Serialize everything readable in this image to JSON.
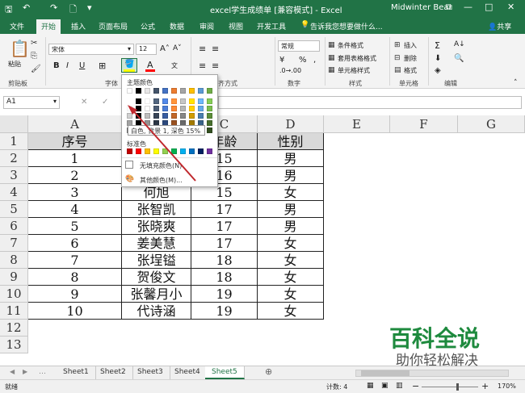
{
  "window": {
    "title": "excel学生成绩单 [兼容模式] - Excel",
    "user": "Midwinter Bear",
    "minimize": "—",
    "maximize": "□",
    "close": "✕",
    "restore": "⧉"
  },
  "quick_access": {
    "save": "🖫",
    "undo": "↶",
    "redo": "↷",
    "new": "🗋",
    "more": "▾"
  },
  "tabs": [
    "文件",
    "开始",
    "插入",
    "页面布局",
    "公式",
    "数据",
    "审阅",
    "视图",
    "开发工具"
  ],
  "active_tab": "开始",
  "tell_me": "告诉我您想要做什么...",
  "share": "共享",
  "ribbon": {
    "paste": "粘贴",
    "clipboard_group": "剪贴板",
    "font_name": "宋体",
    "font_size": "12",
    "bold": "B",
    "italic": "I",
    "underline": "U",
    "font_color_letter": "A",
    "font_group": "字体",
    "align_group": "对齐方式",
    "number_format": "常规",
    "currency": "¥",
    "percent": "%",
    "comma": ",",
    "number_group": "数字",
    "conditional_format": "条件格式",
    "table_format": "套用表格格式",
    "cell_style": "单元格样式",
    "styles_group": "样式",
    "insert": "插入",
    "delete": "删除",
    "format": "格式",
    "cells_group": "单元格",
    "editing_group": "编辑",
    "sum_icon": "Σ",
    "sort_icon": "A↓"
  },
  "formula_bar": {
    "name_box": "A1",
    "cancel": "✕",
    "confirm": "✓",
    "fx": "fx"
  },
  "palette": {
    "theme_title": "主题颜色",
    "standard_title": "标准色",
    "no_fill": "无填充颜色(N)",
    "more_colors": "其他颜色(M)...",
    "tooltip": "白色, 背景 1, 深色 15%",
    "theme_row": [
      "#ffffff",
      "#000000",
      "#e7e6e6",
      "#44546a",
      "#4472c4",
      "#ed7d31",
      "#a5a5a5",
      "#ffc000",
      "#5b9bd5",
      "#70ad47"
    ],
    "standard_row": [
      "#c00000",
      "#ff0000",
      "#ffc000",
      "#ffff00",
      "#92d050",
      "#00b050",
      "#00b0f0",
      "#0070c0",
      "#002060",
      "#7030a0"
    ]
  },
  "columns": [
    "A",
    "B",
    "C",
    "D",
    "E",
    "F",
    "G"
  ],
  "rows": [
    "1",
    "2",
    "3",
    "4",
    "5",
    "6",
    "7",
    "8",
    "9",
    "10",
    "11",
    "12",
    "13"
  ],
  "table": {
    "headers": [
      "序号",
      "",
      "年龄",
      "性别"
    ],
    "data": [
      [
        "1",
        "",
        "15",
        "男"
      ],
      [
        "2",
        "",
        "16",
        "男"
      ],
      [
        "3",
        "何旭",
        "15",
        "女"
      ],
      [
        "4",
        "张智凯",
        "17",
        "男"
      ],
      [
        "5",
        "张晓爽",
        "17",
        "男"
      ],
      [
        "6",
        "姜美慧",
        "17",
        "女"
      ],
      [
        "7",
        "张埕镒",
        "18",
        "女"
      ],
      [
        "8",
        "贺俊文",
        "18",
        "女"
      ],
      [
        "9",
        "张馨月小",
        "19",
        "女"
      ],
      [
        "10",
        "代诗涵",
        "19",
        "女"
      ]
    ]
  },
  "sheets": [
    "Sheet1",
    "Sheet2",
    "Sheet3",
    "Sheet4",
    "Sheet5"
  ],
  "active_sheet": "Sheet5",
  "add_sheet": "⊕",
  "status": {
    "ready": "就绪",
    "count": "计数: 4",
    "zoom": "170%",
    "zoom_minus": "−",
    "zoom_plus": "+"
  },
  "watermark": {
    "line1": "百科全说",
    "line2": "助你轻松解决"
  }
}
